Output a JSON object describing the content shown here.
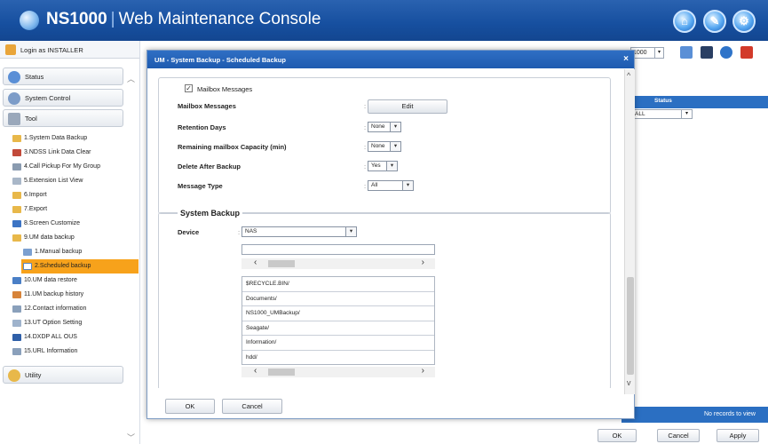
{
  "header": {
    "product": "NS1000",
    "separator": "|",
    "console": "Web Maintenance Console",
    "buttons": [
      "home-icon",
      "wrench-icon",
      "settings-icon"
    ]
  },
  "sidebar": {
    "login": "Login as INSTALLER",
    "categories": [
      {
        "label": "Status",
        "icon": "status-icon"
      },
      {
        "label": "System Control",
        "icon": "system-control-icon"
      },
      {
        "label": "Tool",
        "icon": "tool-icon"
      }
    ],
    "items": [
      {
        "label": "1.System Data Backup",
        "icon": "folder-icon"
      },
      {
        "label": "3.NDSS Link Data Clear",
        "icon": "link-icon"
      },
      {
        "label": "4.Call Pickup For My Group",
        "icon": "phone-icon"
      },
      {
        "label": "5.Extension List View",
        "icon": "list-icon"
      },
      {
        "label": "6.Import",
        "icon": "folder-icon"
      },
      {
        "label": "7.Export",
        "icon": "folder-icon"
      },
      {
        "label": "8.Screen Customize",
        "icon": "screen-icon"
      },
      {
        "label": "9.UM data backup",
        "icon": "folder-open-icon"
      },
      {
        "label": "1.Manual backup",
        "icon": "manual-icon",
        "sub": true
      },
      {
        "label": "2.Scheduled backup",
        "icon": "calendar-icon",
        "sub": true,
        "active": true
      },
      {
        "label": "10.UM data restore",
        "icon": "restore-icon"
      },
      {
        "label": "11.UM backup history",
        "icon": "history-icon"
      },
      {
        "label": "12.Contact information",
        "icon": "contact-icon"
      },
      {
        "label": "13.UT Option Setting",
        "icon": "option-icon"
      },
      {
        "label": "14.DXDP ALL OUS",
        "icon": "network-icon"
      },
      {
        "label": "15.URL Information",
        "icon": "url-icon"
      }
    ],
    "utility": {
      "label": "Utility",
      "icon": "utility-icon"
    }
  },
  "background": {
    "select_value": "1000",
    "status_header": "Status",
    "status_filter": "ALL",
    "no_records": "No records to view",
    "ok": "OK",
    "cancel": "Cancel",
    "apply": "Apply"
  },
  "modal": {
    "title": "UM - System Backup - Scheduled Backup",
    "close": "×",
    "mailbox_checkbox": "Mailbox Messages",
    "mailbox_checked": true,
    "fields": {
      "mailbox_messages": {
        "label": "Mailbox Messages",
        "button": "Edit"
      },
      "retention_days": {
        "label": "Retention Days",
        "value": "None"
      },
      "remaining_capacity": {
        "label": "Remaining mailbox Capacity (min)",
        "value": "None"
      },
      "delete_after": {
        "label": "Delete After Backup",
        "value": "Yes"
      },
      "message_type": {
        "label": "Message Type",
        "value": "All"
      }
    },
    "system_backup": {
      "legend": "System Backup",
      "device_label": "Device",
      "device_value": "NAS",
      "path_value": "",
      "directories": [
        "$RECYCLE.BIN/",
        "Documents/",
        "NS1000_UMBackup/",
        "Seagate/",
        "Information/",
        "hdd/"
      ]
    },
    "ok": "OK",
    "cancel": "Cancel"
  }
}
